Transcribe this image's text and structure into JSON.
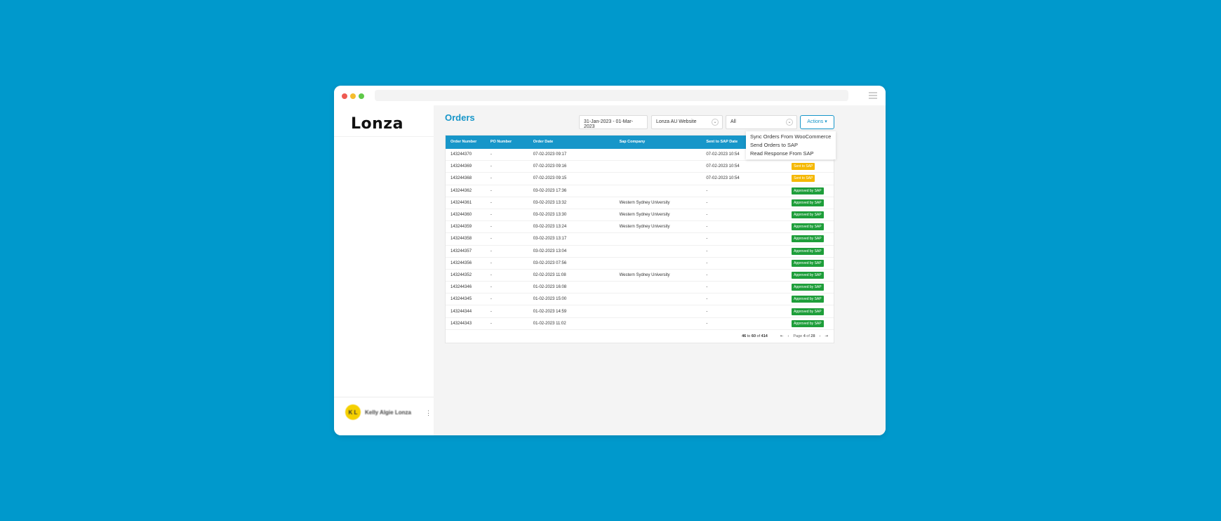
{
  "colors": {
    "background": "#0099cc",
    "accent": "#1796c9",
    "approved": "#1e9e3a",
    "sent": "#f5b800"
  },
  "sidebar": {
    "logo": "Lonza",
    "user": {
      "initials": "K L",
      "name": "Kelly Algie Lonza",
      "more": "⋮"
    }
  },
  "main": {
    "title": "Orders",
    "filters": {
      "date_range": "31-Jan-2023 - 01-Mar-2023",
      "website": "Lonza AU Website",
      "status": "All"
    },
    "actions_label": "Actions",
    "actions_menu": [
      "Sync Orders From WooCommerce",
      "Send Orders to SAP",
      "Read Response From SAP"
    ]
  },
  "table": {
    "headers": [
      "Order Number",
      "PO Number",
      "Order Date",
      "Sap Company",
      "Sent to SAP Date",
      "Status"
    ],
    "rows": [
      {
        "order": "143244370",
        "po": "-",
        "date": "07-02-2023 09:17",
        "company": "",
        "sent": "07-02-2023 10:54",
        "status": "",
        "kind": "none"
      },
      {
        "order": "143244369",
        "po": "-",
        "date": "07-02-2023 09:16",
        "company": "",
        "sent": "07-02-2023 10:54",
        "status": "Sent to SAP",
        "kind": "sent"
      },
      {
        "order": "143244368",
        "po": "-",
        "date": "07-02-2023 09:15",
        "company": "",
        "sent": "07-02-2023 10:54",
        "status": "Sent to SAP",
        "kind": "sent"
      },
      {
        "order": "143244362",
        "po": "-",
        "date": "03-02-2023 17:36",
        "company": "",
        "sent": "-",
        "status": "Approved by SAP",
        "kind": "approved"
      },
      {
        "order": "143244361",
        "po": "-",
        "date": "03-02-2023 13:32",
        "company": "Western Sydney University",
        "sent": "-",
        "status": "Approved by SAP",
        "kind": "approved"
      },
      {
        "order": "143244360",
        "po": "-",
        "date": "03-02-2023 13:30",
        "company": "Western Sydney University",
        "sent": "-",
        "status": "Approved by SAP",
        "kind": "approved"
      },
      {
        "order": "143244359",
        "po": "-",
        "date": "03-02-2023 13:24",
        "company": "Western Sydney University",
        "sent": "-",
        "status": "Approved by SAP",
        "kind": "approved"
      },
      {
        "order": "143244358",
        "po": "-",
        "date": "03-02-2023 13:17",
        "company": "",
        "sent": "-",
        "status": "Approved by SAP",
        "kind": "approved"
      },
      {
        "order": "143244357",
        "po": "-",
        "date": "03-02-2023 13:04",
        "company": "",
        "sent": "-",
        "status": "Approved by SAP",
        "kind": "approved"
      },
      {
        "order": "143244356",
        "po": "-",
        "date": "03-02-2023 07:56",
        "company": "",
        "sent": "-",
        "status": "Approved by SAP",
        "kind": "approved"
      },
      {
        "order": "143244352",
        "po": "-",
        "date": "02-02-2023 11:08",
        "company": "Western Sydney University",
        "sent": "-",
        "status": "Approved by SAP",
        "kind": "approved"
      },
      {
        "order": "143244346",
        "po": "-",
        "date": "01-02-2023 16:08",
        "company": "",
        "sent": "-",
        "status": "Approved by SAP",
        "kind": "approved"
      },
      {
        "order": "143244345",
        "po": "-",
        "date": "01-02-2023 15:00",
        "company": "",
        "sent": "-",
        "status": "Approved by SAP",
        "kind": "approved"
      },
      {
        "order": "143244344",
        "po": "-",
        "date": "01-02-2023 14:59",
        "company": "",
        "sent": "-",
        "status": "Approved by SAP",
        "kind": "approved"
      },
      {
        "order": "143244343",
        "po": "-",
        "date": "01-02-2023 11:02",
        "company": "",
        "sent": "-",
        "status": "Approved by SAP",
        "kind": "approved"
      }
    ],
    "pager": {
      "from": "46",
      "to_word": "to",
      "to": "60",
      "of_word": "of",
      "total": "414",
      "page_word": "Page",
      "page": "4",
      "page_of_word": "of",
      "pages": "28"
    }
  }
}
